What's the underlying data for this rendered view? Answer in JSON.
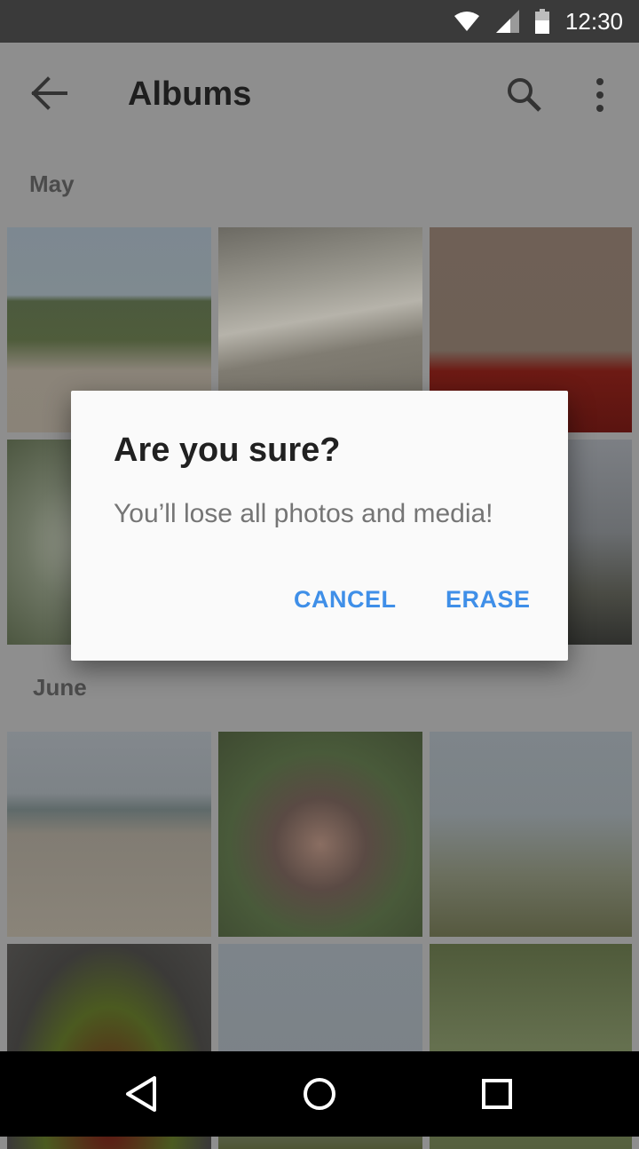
{
  "status_bar": {
    "time": "12:30"
  },
  "app_bar": {
    "title": "Albums"
  },
  "sections": [
    {
      "label": "May"
    },
    {
      "label": "June"
    }
  ],
  "dialog": {
    "title": "Are you sure?",
    "message": "You’ll lose all photos and media!",
    "cancel_label": "CANCEL",
    "confirm_label": "ERASE"
  }
}
